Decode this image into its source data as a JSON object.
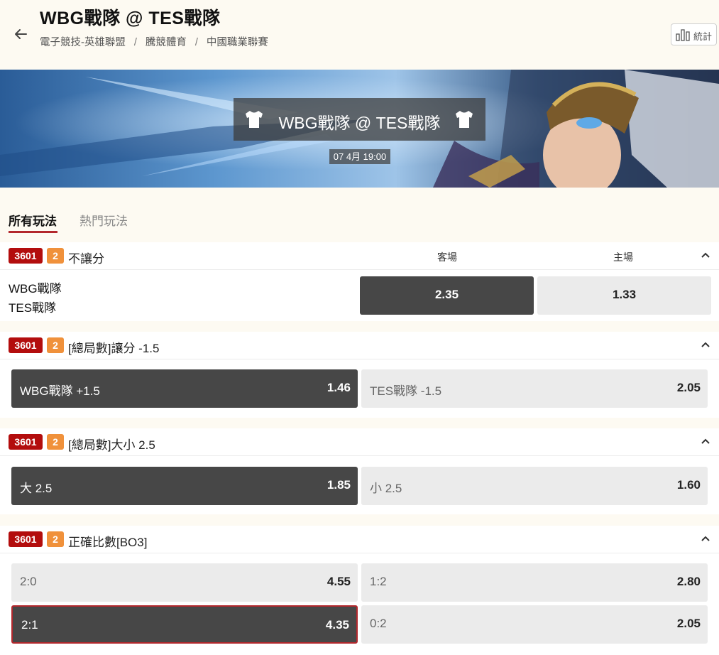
{
  "header": {
    "title": "WBG戰隊 @ TES戰隊",
    "breadcrumbs": [
      "電子競技-英雄聯盟",
      "騰競體育",
      "中國職業聯賽"
    ],
    "stats_label": "統計"
  },
  "banner": {
    "title": "WBG戰隊 @ TES戰隊",
    "date": "07 4月 19:00"
  },
  "tabs": [
    {
      "label": "所有玩法",
      "active": true
    },
    {
      "label": "熱門玩法",
      "active": false
    }
  ],
  "markets": [
    {
      "id": "3601",
      "count": "2",
      "name": "不讓分",
      "col_away": "客場",
      "col_home": "主場",
      "team_away": "WBG戰隊",
      "team_home": "TES戰隊",
      "odds": [
        {
          "value": "2.35",
          "style": "dark"
        },
        {
          "value": "1.33",
          "style": "light"
        }
      ]
    },
    {
      "id": "3601",
      "count": "2",
      "name": "[總局數]讓分 -1.5",
      "odds": [
        {
          "label": "WBG戰隊 +1.5",
          "value": "1.46",
          "style": "dark"
        },
        {
          "label": "TES戰隊 -1.5",
          "value": "2.05",
          "style": "light"
        }
      ]
    },
    {
      "id": "3601",
      "count": "2",
      "name": "[總局數]大小 2.5",
      "odds": [
        {
          "label": "大 2.5",
          "value": "1.85",
          "style": "dark"
        },
        {
          "label": "小 2.5",
          "value": "1.60",
          "style": "light"
        }
      ]
    },
    {
      "id": "3601",
      "count": "2",
      "name": "正確比數[BO3]",
      "odds": [
        {
          "label": "2:0",
          "value": "4.55",
          "style": "light"
        },
        {
          "label": "1:2",
          "value": "2.80",
          "style": "light"
        },
        {
          "label": "2:1",
          "value": "4.35",
          "style": "dark-selected"
        },
        {
          "label": "0:2",
          "value": "2.05",
          "style": "light"
        }
      ]
    }
  ],
  "colors": {
    "badge_id": "#b30d0d",
    "badge_count": "#f0913b",
    "accent": "#b3282d",
    "dark_odd": "#474747",
    "light_odd": "#ebebeb"
  }
}
